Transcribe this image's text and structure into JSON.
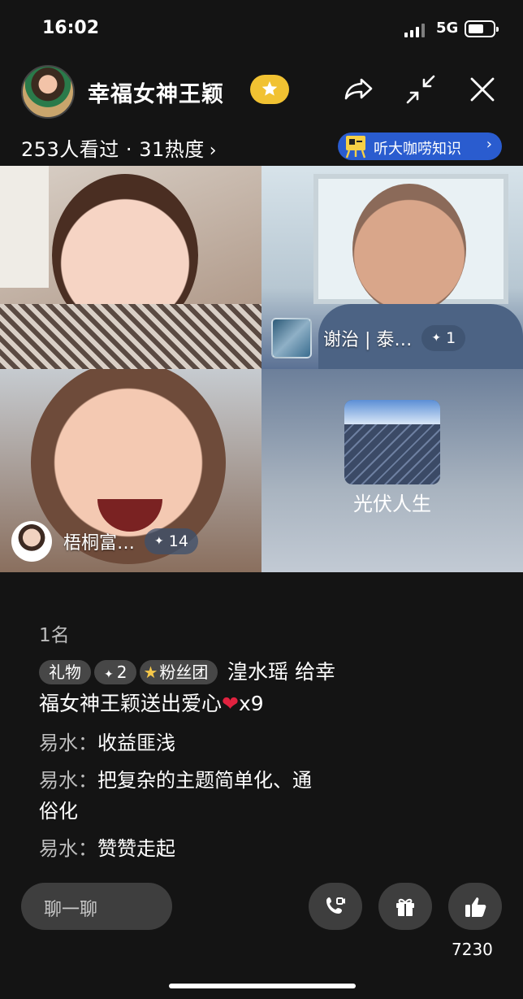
{
  "status_bar": {
    "time": "16:02",
    "network": "5G"
  },
  "header": {
    "host_name": "幸福女神王颖"
  },
  "stats": {
    "viewers": "253人看过 · 31热度",
    "chevron": "›"
  },
  "promo": {
    "label": "听大咖唠知识",
    "chevron": "›"
  },
  "tiles": {
    "top_right": {
      "name": "谢治 | 泰…",
      "badge": "1"
    },
    "bottom_left": {
      "name": "梧桐富…",
      "badge": "14"
    },
    "bottom_right": {
      "name": "光伏人生"
    }
  },
  "chat": {
    "rank": "1名",
    "gift": {
      "tag_gift": "礼物",
      "tag_level": "2",
      "tag_fans": "粉丝团",
      "line1": "湟水瑶 给幸",
      "line2_prefix": "福女神王颖送出爱心",
      "heart": "❤",
      "line2_suffix": "x9"
    },
    "messages": [
      {
        "user": "易水：",
        "text": "收益匪浅"
      },
      {
        "user": "易水：",
        "text": "把复杂的主题简单化、通"
      },
      {
        "user": "",
        "text": "俗化"
      },
      {
        "user": "易水：",
        "text": "赞赞走起"
      }
    ]
  },
  "bottom": {
    "chat_placeholder": "聊一聊",
    "like_count": "7230"
  }
}
